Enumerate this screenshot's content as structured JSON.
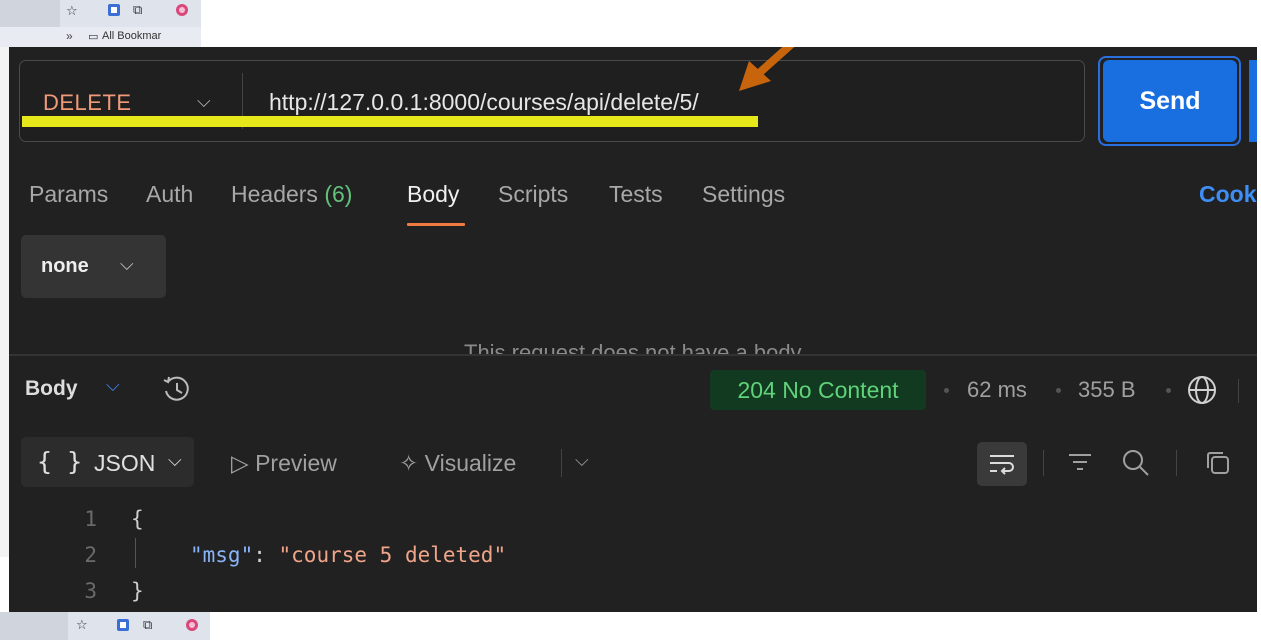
{
  "browser": {
    "bookmarks_overflow": "»",
    "bookmarks_label": "All Bookmar"
  },
  "request": {
    "method": "DELETE",
    "url": "http://127.0.0.1:8000/courses/api/delete/5/",
    "send_label": "Send"
  },
  "tabs": {
    "params": "Params",
    "auth": "Auth",
    "headers": "Headers",
    "headers_count": "(6)",
    "body": "Body",
    "scripts": "Scripts",
    "tests": "Tests",
    "settings": "Settings",
    "cookies": "Cook"
  },
  "body_type": "none",
  "no_body_message": "This request does not have a body",
  "response": {
    "body_label": "Body",
    "status": "204 No Content",
    "time": "62 ms",
    "size": "355 B",
    "format": "JSON",
    "format_braces": "{ }",
    "preview": "Preview",
    "visualize": "Visualize",
    "lines": [
      {
        "num": "1",
        "text": "{"
      },
      {
        "num": "2",
        "key": "\"msg\"",
        "sep": ": ",
        "value": "\"course 5 deleted\""
      },
      {
        "num": "3",
        "text": "}"
      }
    ]
  },
  "colors": {
    "method": "#f09a7a",
    "send": "#1a6fe0",
    "status_text": "#5fd27a",
    "highlight": "#e6e81a",
    "arrow": "#c8650c"
  }
}
